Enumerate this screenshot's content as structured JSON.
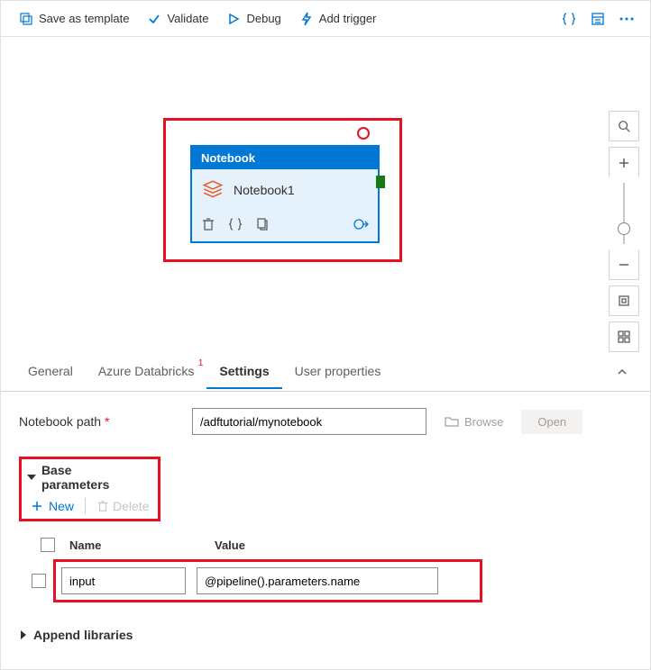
{
  "toolbar": {
    "save_template": "Save as template",
    "validate": "Validate",
    "debug": "Debug",
    "add_trigger": "Add trigger"
  },
  "node": {
    "type_label": "Notebook",
    "name": "Notebook1"
  },
  "tabs": {
    "general": "General",
    "databricks": "Azure Databricks",
    "settings": "Settings",
    "user_props": "User properties"
  },
  "settings_panel": {
    "path_label": "Notebook path",
    "path_value": "/adftutorial/mynotebook",
    "browse": "Browse",
    "open": "Open",
    "base_params_label": "Base parameters",
    "new_label": "New",
    "delete_label": "Delete",
    "col_name": "Name",
    "col_value": "Value",
    "row": {
      "name": "input",
      "value": "@pipeline().parameters.name"
    },
    "append_label": "Append libraries"
  }
}
